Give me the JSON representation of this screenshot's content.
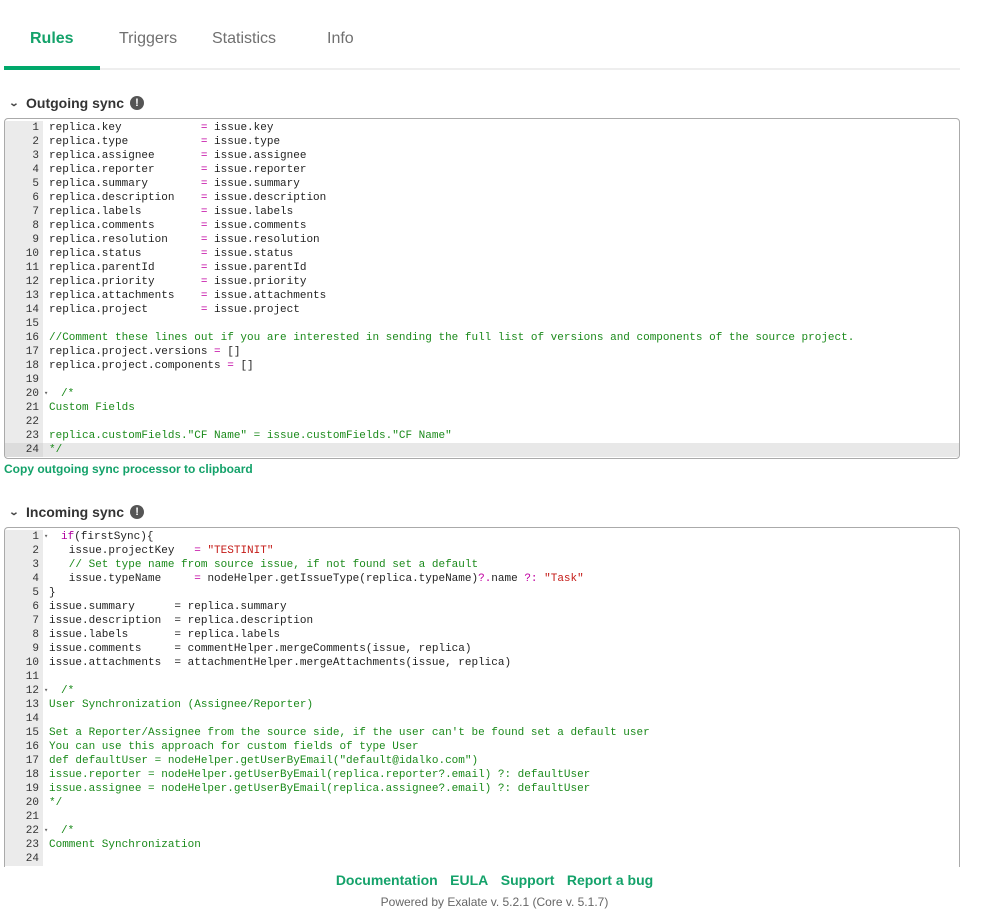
{
  "tabs": [
    "Rules",
    "Triggers",
    "Statistics",
    "Info"
  ],
  "outgoing": {
    "title": "Outgoing sync",
    "copy_label": "Copy outgoing sync processor to clipboard",
    "lines": [
      {
        "n": "1",
        "t": [
          [
            "d",
            "replica.key            "
          ],
          [
            "op",
            "="
          ],
          [
            "d",
            " issue.key"
          ]
        ]
      },
      {
        "n": "2",
        "t": [
          [
            "d",
            "replica.type           "
          ],
          [
            "op",
            "="
          ],
          [
            "d",
            " issue.type"
          ]
        ]
      },
      {
        "n": "3",
        "t": [
          [
            "d",
            "replica.assignee       "
          ],
          [
            "op",
            "="
          ],
          [
            "d",
            " issue.assignee"
          ]
        ]
      },
      {
        "n": "4",
        "t": [
          [
            "d",
            "replica.reporter       "
          ],
          [
            "op",
            "="
          ],
          [
            "d",
            " issue.reporter"
          ]
        ]
      },
      {
        "n": "5",
        "t": [
          [
            "d",
            "replica.summary        "
          ],
          [
            "op",
            "="
          ],
          [
            "d",
            " issue.summary"
          ]
        ]
      },
      {
        "n": "6",
        "t": [
          [
            "d",
            "replica.description    "
          ],
          [
            "op",
            "="
          ],
          [
            "d",
            " issue.description"
          ]
        ]
      },
      {
        "n": "7",
        "t": [
          [
            "d",
            "replica.labels         "
          ],
          [
            "op",
            "="
          ],
          [
            "d",
            " issue.labels"
          ]
        ]
      },
      {
        "n": "8",
        "t": [
          [
            "d",
            "replica.comments       "
          ],
          [
            "op",
            "="
          ],
          [
            "d",
            " issue.comments"
          ]
        ]
      },
      {
        "n": "9",
        "t": [
          [
            "d",
            "replica.resolution     "
          ],
          [
            "op",
            "="
          ],
          [
            "d",
            " issue.resolution"
          ]
        ]
      },
      {
        "n": "10",
        "t": [
          [
            "d",
            "replica.status         "
          ],
          [
            "op",
            "="
          ],
          [
            "d",
            " issue.status"
          ]
        ]
      },
      {
        "n": "11",
        "t": [
          [
            "d",
            "replica.parentId       "
          ],
          [
            "op",
            "="
          ],
          [
            "d",
            " issue.parentId"
          ]
        ]
      },
      {
        "n": "12",
        "t": [
          [
            "d",
            "replica.priority       "
          ],
          [
            "op",
            "="
          ],
          [
            "d",
            " issue.priority"
          ]
        ]
      },
      {
        "n": "13",
        "t": [
          [
            "d",
            "replica.attachments    "
          ],
          [
            "op",
            "="
          ],
          [
            "d",
            " issue.attachments"
          ]
        ]
      },
      {
        "n": "14",
        "t": [
          [
            "d",
            "replica.project        "
          ],
          [
            "op",
            "="
          ],
          [
            "d",
            " issue.project"
          ]
        ]
      },
      {
        "n": "15",
        "t": []
      },
      {
        "n": "16",
        "t": [
          [
            "c",
            "//Comment these lines out if you are interested in sending the full list of versions and components of the source project."
          ]
        ]
      },
      {
        "n": "17",
        "t": [
          [
            "d",
            "replica.project.versions "
          ],
          [
            "op",
            "="
          ],
          [
            "d",
            " []"
          ]
        ]
      },
      {
        "n": "18",
        "t": [
          [
            "d",
            "replica.project.components "
          ],
          [
            "op",
            "="
          ],
          [
            "d",
            " []"
          ]
        ]
      },
      {
        "n": "19",
        "t": []
      },
      {
        "n": "20",
        "fold": true,
        "t": [
          [
            "c",
            "/*"
          ]
        ]
      },
      {
        "n": "21",
        "t": [
          [
            "c",
            "Custom Fields"
          ]
        ]
      },
      {
        "n": "22",
        "t": []
      },
      {
        "n": "23",
        "t": [
          [
            "c",
            "replica.customFields.\"CF Name\" = issue.customFields.\"CF Name\""
          ]
        ]
      },
      {
        "n": "24",
        "cur": true,
        "t": [
          [
            "c",
            "*/"
          ]
        ]
      }
    ]
  },
  "incoming": {
    "title": "Incoming sync",
    "lines": [
      {
        "n": "1",
        "fold": true,
        "t": [
          [
            "k",
            "if"
          ],
          [
            "d",
            "(firstSync){"
          ]
        ]
      },
      {
        "n": "2",
        "t": [
          [
            "d",
            "   issue.projectKey   "
          ],
          [
            "op",
            "="
          ],
          [
            "d",
            " "
          ],
          [
            "s",
            "\"TESTINIT\""
          ]
        ]
      },
      {
        "n": "3",
        "t": [
          [
            "c",
            "   // Set type name from source issue, if not found set a default"
          ]
        ]
      },
      {
        "n": "4",
        "t": [
          [
            "d",
            "   issue.typeName     "
          ],
          [
            "op",
            "="
          ],
          [
            "d",
            " nodeHelper.getIssueType(replica.typeName)"
          ],
          [
            "op",
            "?."
          ],
          [
            "d",
            "name "
          ],
          [
            "op",
            "?:"
          ],
          [
            "d",
            " "
          ],
          [
            "s",
            "\"Task\""
          ]
        ]
      },
      {
        "n": "5",
        "t": [
          [
            "d",
            "}"
          ]
        ]
      },
      {
        "n": "6",
        "t": [
          [
            "d",
            "issue.summary      = replica.summary"
          ]
        ]
      },
      {
        "n": "7",
        "t": [
          [
            "d",
            "issue.description  = replica.description"
          ]
        ]
      },
      {
        "n": "8",
        "t": [
          [
            "d",
            "issue.labels       = replica.labels"
          ]
        ]
      },
      {
        "n": "9",
        "t": [
          [
            "d",
            "issue.comments     = commentHelper.mergeComments(issue, replica)"
          ]
        ]
      },
      {
        "n": "10",
        "t": [
          [
            "d",
            "issue.attachments  = attachmentHelper.mergeAttachments(issue, replica)"
          ]
        ]
      },
      {
        "n": "11",
        "t": []
      },
      {
        "n": "12",
        "fold": true,
        "t": [
          [
            "c",
            "/*"
          ]
        ]
      },
      {
        "n": "13",
        "t": [
          [
            "c",
            "User Synchronization (Assignee/Reporter)"
          ]
        ]
      },
      {
        "n": "14",
        "t": []
      },
      {
        "n": "15",
        "t": [
          [
            "c",
            "Set a Reporter/Assignee from the source side, if the user can't be found set a default user"
          ]
        ]
      },
      {
        "n": "16",
        "t": [
          [
            "c",
            "You can use this approach for custom fields of type User"
          ]
        ]
      },
      {
        "n": "17",
        "t": [
          [
            "c",
            "def defaultUser = nodeHelper.getUserByEmail(\"default@idalko.com\")"
          ]
        ]
      },
      {
        "n": "18",
        "t": [
          [
            "c",
            "issue.reporter = nodeHelper.getUserByEmail(replica.reporter?.email) ?: defaultUser"
          ]
        ]
      },
      {
        "n": "19",
        "t": [
          [
            "c",
            "issue.assignee = nodeHelper.getUserByEmail(replica.assignee?.email) ?: defaultUser"
          ]
        ]
      },
      {
        "n": "20",
        "t": [
          [
            "c",
            "*/"
          ]
        ]
      },
      {
        "n": "21",
        "t": []
      },
      {
        "n": "22",
        "fold": true,
        "t": [
          [
            "c",
            "/*"
          ]
        ]
      },
      {
        "n": "23",
        "t": [
          [
            "c",
            "Comment Synchronization"
          ]
        ]
      },
      {
        "n": "24",
        "t": []
      }
    ]
  },
  "footer": {
    "links": [
      "Documentation",
      "EULA",
      "Support",
      "Report a bug"
    ],
    "powered": "Powered by Exalate v. 5.2.1 (Core v. 5.1.7)"
  }
}
